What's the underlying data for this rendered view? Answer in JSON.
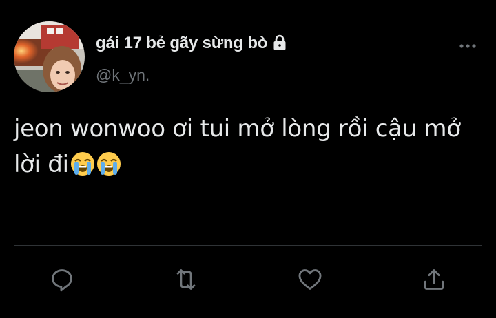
{
  "tweet": {
    "author": {
      "display_name": "gái 17 bẻ gãy sừng bò",
      "handle": "@k_yn.",
      "protected": true
    },
    "text_line1": "jeon wonwoo ơi tui mở lòng rồi cậu mở",
    "text_line2": "lời đi",
    "emojis": [
      "loudly-crying-face",
      "loudly-crying-face"
    ]
  },
  "icons": {
    "more": "more-horizontal-icon",
    "reply": "reply-icon",
    "retweet": "retweet-icon",
    "like": "heart-icon",
    "share": "share-icon",
    "lock": "lock-icon"
  },
  "colors": {
    "background": "#000000",
    "primary_text": "#e7e9ea",
    "secondary_text": "#71767b",
    "divider": "#2f3336"
  }
}
